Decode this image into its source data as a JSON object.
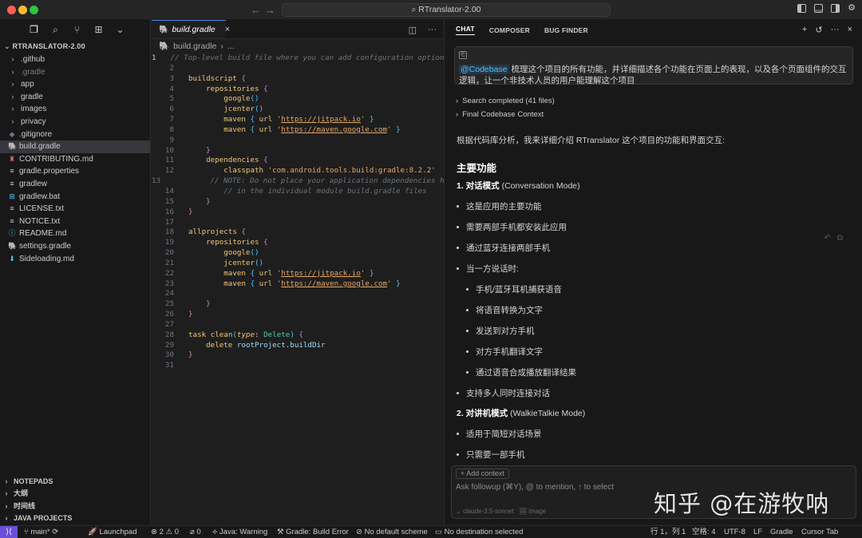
{
  "window": {
    "title": "RTranslator-2.00"
  },
  "explorer": {
    "title": "RTRANSLATOR-2.00",
    "items": [
      {
        "label": ".github",
        "type": "folder",
        "dim": false
      },
      {
        "label": ".gradle",
        "type": "folder",
        "dim": true
      },
      {
        "label": "app",
        "type": "folder",
        "dim": false
      },
      {
        "label": "gradle",
        "type": "folder",
        "dim": false
      },
      {
        "label": "images",
        "type": "folder",
        "dim": false
      },
      {
        "label": "privacy",
        "type": "folder",
        "dim": false
      },
      {
        "label": ".gitignore",
        "type": "file",
        "icon": "gitignore-icon",
        "glyph": "◆",
        "color": "#6e7681"
      },
      {
        "label": "build.gradle",
        "type": "file",
        "icon": "gradle-icon",
        "glyph": "🐘",
        "color": "#4f9fcf",
        "selected": true
      },
      {
        "label": "CONTRIBUTING.md",
        "type": "file",
        "icon": "contributing-icon",
        "glyph": "♜",
        "color": "#e06c75"
      },
      {
        "label": "gradle.properties",
        "type": "file",
        "icon": "properties-icon",
        "glyph": "≡",
        "color": "#cccccc"
      },
      {
        "label": "gradlew",
        "type": "file",
        "icon": "text-file-icon",
        "glyph": "≡",
        "color": "#cccccc"
      },
      {
        "label": "gradlew.bat",
        "type": "file",
        "icon": "windows-icon",
        "glyph": "⊞",
        "color": "#4fc1ff"
      },
      {
        "label": "LICENSE.txt",
        "type": "file",
        "icon": "text-file-icon",
        "glyph": "≡",
        "color": "#cccccc"
      },
      {
        "label": "NOTICE.txt",
        "type": "file",
        "icon": "text-file-icon",
        "glyph": "≡",
        "color": "#cccccc"
      },
      {
        "label": "README.md",
        "type": "file",
        "icon": "info-icon",
        "glyph": "ⓘ",
        "color": "#4fc1ff"
      },
      {
        "label": "settings.gradle",
        "type": "file",
        "icon": "gradle-icon",
        "glyph": "🐘",
        "color": "#4f9fcf"
      },
      {
        "label": "Sideloading.md",
        "type": "file",
        "icon": "markdown-icon",
        "glyph": "⬇",
        "color": "#4fc1ff"
      }
    ],
    "sections": [
      "NOTEPADS",
      "大纲",
      "时间线",
      "JAVA PROJECTS"
    ]
  },
  "editor": {
    "tab_label": "build.gradle",
    "breadcrumb": [
      "build.gradle",
      "..."
    ],
    "current_line": 1
  },
  "chat": {
    "tabs": [
      "CHAT",
      "COMPOSER",
      "BUG FINDER"
    ],
    "prompt_mention": "@Codebase",
    "prompt_text": " 梳理这个项目的所有功能，并详细描述各个功能在页面上的表现，以及各个页面组件的交互逻辑，让一个非技术人员的用户能理解这个项目",
    "collapsed": [
      "Search completed (41 files)",
      "Final Codebase Context"
    ],
    "intro": "根据代码库分析，我来详细介绍 RTranslator 这个项目的功能和界面交互:",
    "heading": "主要功能",
    "sub1_bold": "1. 对话模式",
    "sub1_rest": " (Conversation Mode)",
    "bullets_a": [
      "这是应用的主要功能",
      "需要两部手机都安装此应用",
      "通过蓝牙连接两部手机",
      "当一方说话时:"
    ],
    "bullets_b": [
      "手机/蓝牙耳机捕获语音",
      "将语音转换为文字",
      "发送到对方手机",
      "对方手机翻译文字",
      "通过语音合成播放翻译结果"
    ],
    "bullet_c": "支持多人同时连接对话",
    "sub2_bold": "2. 对讲机模式",
    "sub2_rest": " (WalkieTalkie Mode)",
    "bullets_d": [
      "适用于简短对话场景",
      "只需要一部手机"
    ],
    "add_context": "+ Add context",
    "input_placeholder": "Ask followup (⌘Y), @ to mention, ↑ to select",
    "model": "claude-3.5-sonnet",
    "image_label": "image",
    "watermark": "知乎 @在游牧呐"
  },
  "statusbar": {
    "branch": "main*",
    "launchpad": "Launchpad",
    "errors": "2",
    "warnings": "0",
    "ports": "0",
    "java": "Java: Warning",
    "gradle_status": "Gradle: Build Error",
    "scheme": "No default scheme",
    "destination": "No destination selected",
    "position": "行 1，列 1",
    "spaces": "空格: 4",
    "encoding": "UTF-8",
    "eol": "LF",
    "language": "Gradle",
    "tab": "Cursor Tab"
  }
}
